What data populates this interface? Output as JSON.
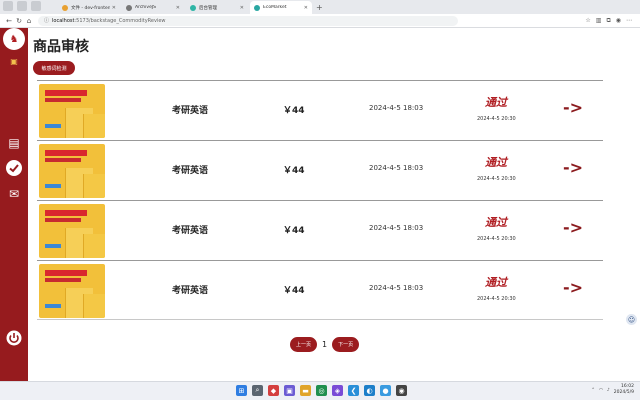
{
  "browser": {
    "tabs": [
      {
        "label": "文件 - dev-frontend - 共享云盘",
        "fav_color": "#e8a030",
        "active": false
      },
      {
        "label": "ArchiveJS",
        "fav_color": "#777777",
        "active": false
      },
      {
        "label": "后台管理",
        "fav_color": "#2eb5a6",
        "active": false
      },
      {
        "label": "EcoMarket",
        "fav_color": "#2aa7a2",
        "active": true
      }
    ],
    "url_host": "localhost",
    "url_path": ":5173/backstage_CommodityReview"
  },
  "sidebar": {
    "logo_icon": "brand-logo",
    "items": [
      {
        "name": "goods-icon",
        "glyph": "▤"
      },
      {
        "name": "check-icon",
        "glyph": "✔"
      },
      {
        "name": "message-icon",
        "glyph": "✉"
      },
      {
        "name": "power-icon",
        "glyph": "⏻"
      }
    ]
  },
  "page": {
    "title": "商品审核",
    "check_button": "敏感词检测"
  },
  "commodities": [
    {
      "name": "考研英语",
      "price": "￥44",
      "time": "2024-4-5 18:03",
      "status": "通过",
      "review_time": "2024-4-5 20:30",
      "arrow": "->"
    },
    {
      "name": "考研英语",
      "price": "￥44",
      "time": "2024-4-5 18:03",
      "status": "通过",
      "review_time": "2024-4-5 20:30",
      "arrow": "->"
    },
    {
      "name": "考研英语",
      "price": "￥44",
      "time": "2024-4-5 18:03",
      "status": "通过",
      "review_time": "2024-4-5 20:30",
      "arrow": "->"
    },
    {
      "name": "考研英语",
      "price": "￥44",
      "time": "2024-4-5 18:03",
      "status": "通过",
      "review_time": "2024-4-5 20:30",
      "arrow": "->"
    }
  ],
  "pagination": {
    "prev": "上一页",
    "current": "1",
    "next": "下一页"
  },
  "taskbar": {
    "time": "16:02",
    "date": "2024/5/9"
  },
  "colors": {
    "brand": "#961b1e",
    "button": "#9b1c1f",
    "status": "#b01e23"
  }
}
